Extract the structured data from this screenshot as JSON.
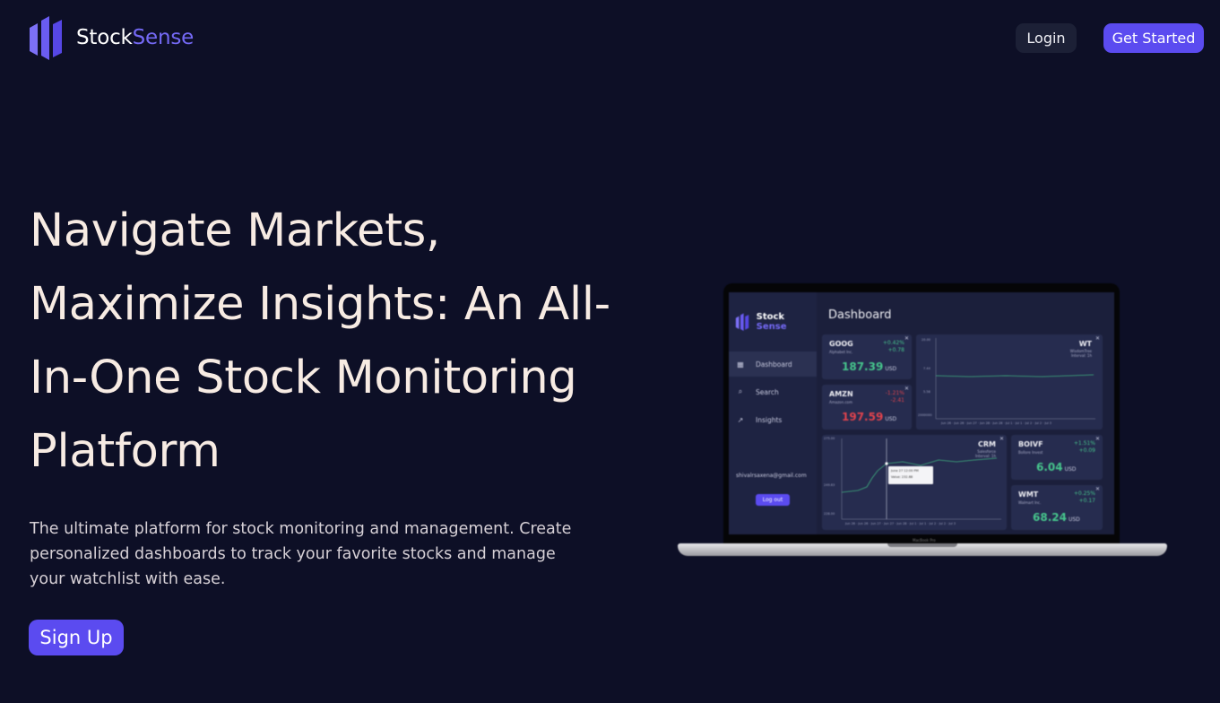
{
  "header": {
    "logo_primary": "Stock",
    "logo_accent": "Sense",
    "login_label": "Login",
    "get_started_label": "Get Started"
  },
  "hero": {
    "title_lines": [
      "Navigate Markets,",
      "Maximize Insights: An All-",
      "In-One Stock Monitoring",
      "Platform"
    ],
    "description": "The ultimate platform for stock monitoring and management. Create personalized dashboards to track your favorite stocks and manage your watchlist with ease.",
    "signup_label": "Sign Up"
  },
  "mockup": {
    "logo_primary": "Stock",
    "logo_accent": "Sense",
    "title": "Dashboard",
    "nav": [
      {
        "label": "Dashboard",
        "icon": "grid-icon",
        "active": true
      },
      {
        "label": "Search",
        "icon": "search-icon",
        "active": false
      },
      {
        "label": "Insights",
        "icon": "trend-icon",
        "active": false
      }
    ],
    "email": "shivalrsaxena@gmail.com",
    "logout_label": "Log out",
    "device_label": "MacBook Pro",
    "cards": [
      {
        "ticker": "GOOG",
        "company": "Alphabet Inc.",
        "change_pct": "+0.42%",
        "change": "+0.78",
        "price": "187.39",
        "currency": "USD",
        "direction": "up"
      },
      {
        "ticker": "AMZN",
        "company": "Amazon.com",
        "change_pct": "-1.21%",
        "change": "-2.41",
        "price": "197.59",
        "currency": "USD",
        "direction": "down"
      },
      {
        "ticker": "BOIVF",
        "company": "Bollore Invest",
        "change_pct": "+1.51%",
        "change": "+0.09",
        "price": "6.04",
        "currency": "USD",
        "direction": "up"
      },
      {
        "ticker": "WMT",
        "company": "Walmart Inc.",
        "change_pct": "+0.25%",
        "change": "+0.17",
        "price": "68.24",
        "currency": "USD",
        "direction": "up"
      }
    ],
    "charts": [
      {
        "ticker": "WT",
        "company": "WisdomTree",
        "subtitle": "Interval: 1h",
        "y_ticks": [
          "20.00",
          "7.44",
          "5.58",
          "2000000"
        ],
        "x_ticks": [
          "Jun 26",
          "Jun 26",
          "Jun 27",
          "Jun 28",
          "Jun 28",
          "Jul 1",
          "Jul 1",
          "Jul 2",
          "Jul 2",
          "Jul 3"
        ]
      },
      {
        "ticker": "CRM",
        "company": "Salesforce",
        "subtitle": "Interval: 1h",
        "y_ticks": [
          "275.00",
          "249.63",
          "228.00"
        ],
        "x_ticks": [
          "Jun 26",
          "Jun 26",
          "Jun 27",
          "Jun 27",
          "Jun 28",
          "Jul 1",
          "Jul 1",
          "Jul 2",
          "Jul 2",
          "Jul 3"
        ],
        "tooltip_date": "June 27 12:00 PM",
        "tooltip_value": "Value: 232.68"
      }
    ]
  }
}
